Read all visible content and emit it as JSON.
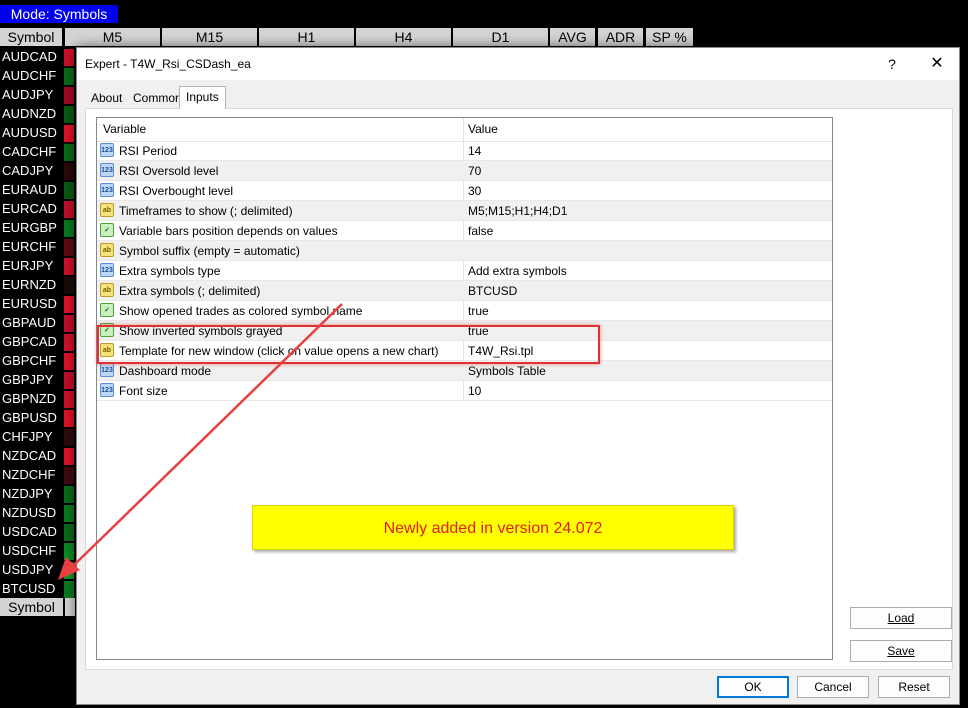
{
  "dashboard": {
    "mode_label": "Mode: Symbols",
    "header": [
      "Symbol",
      "M5",
      "M15",
      "H1",
      "H4",
      "D1",
      "AVG",
      "ADR",
      "SP %"
    ],
    "symbols": [
      "AUDCAD",
      "AUDCHF",
      "AUDJPY",
      "AUDNZD",
      "AUDUSD",
      "CADCHF",
      "CADJPY",
      "EURAUD",
      "EURCAD",
      "EURGBP",
      "EURCHF",
      "EURJPY",
      "EURNZD",
      "EURUSD",
      "GBPAUD",
      "GBPCAD",
      "GBPCHF",
      "GBPJPY",
      "GBPNZD",
      "GBPUSD",
      "CHFJPY",
      "NZDCAD",
      "NZDCHF",
      "NZDJPY",
      "NZDUSD",
      "USDCAD",
      "USDCHF",
      "USDJPY",
      "BTCUSD"
    ],
    "cell_colors": [
      "#d0102a",
      "#0a6a1a",
      "#a00a20",
      "#0a5a14",
      "#e0102a",
      "#0a6a1a",
      "#2a0a0a",
      "#0a5a14",
      "#c01028",
      "#0a7a1e",
      "#600a14",
      "#d0102a",
      "#1a0a0a",
      "#e0102a",
      "#c01028",
      "#d0102a",
      "#e0102a",
      "#c01028",
      "#d0102a",
      "#e0102a",
      "#300a0a",
      "#e0102a",
      "#400a10",
      "#0a6a1a",
      "#0a7a1e",
      "#0a6a1a",
      "#0a8a22",
      "#0a9a26",
      "#0a7a1e"
    ],
    "footer_label": "Symbol"
  },
  "dialog": {
    "title": "Expert - T4W_Rsi_CSDash_ea",
    "help": "?",
    "close": "✕",
    "tabs": [
      "About",
      "Common",
      "Inputs"
    ],
    "active_tab": "Inputs",
    "columns": {
      "variable": "Variable",
      "value": "Value"
    },
    "rows": [
      {
        "icon": "123",
        "type": "num",
        "name": "RSI Period",
        "value": "14"
      },
      {
        "icon": "123",
        "type": "num",
        "name": "RSI Oversold level",
        "value": "70"
      },
      {
        "icon": "123",
        "type": "num",
        "name": "RSI Overbought level",
        "value": "30"
      },
      {
        "icon": "ab",
        "type": "txt",
        "name": "Timeframes to show (; delimited)",
        "value": "M5;M15;H1;H4;D1"
      },
      {
        "icon": "✓",
        "type": "bool",
        "name": "Variable bars position depends on values",
        "value": "false"
      },
      {
        "icon": "ab",
        "type": "txt",
        "name": "Symbol suffix (empty = automatic)",
        "value": ""
      },
      {
        "icon": "123",
        "type": "num",
        "name": "Extra symbols type",
        "value": "Add extra symbols"
      },
      {
        "icon": "ab",
        "type": "txt",
        "name": "Extra symbols (; delimited)",
        "value": "BTCUSD"
      },
      {
        "icon": "✓",
        "type": "bool",
        "name": "Show opened trades as colored symbol name",
        "value": "true"
      },
      {
        "icon": "✓",
        "type": "bool",
        "name": "Show inverted symbols grayed",
        "value": "true"
      },
      {
        "icon": "ab",
        "type": "txt",
        "name": "Template for new window (click on value opens a new chart)",
        "value": "T4W_Rsi.tpl"
      },
      {
        "icon": "123",
        "type": "num",
        "name": "Dashboard mode",
        "value": "Symbols Table"
      },
      {
        "icon": "123",
        "type": "num",
        "name": "Font size",
        "value": "10"
      }
    ],
    "annotation": "Newly added in version 24.072",
    "buttons": {
      "load": "Load",
      "save": "Save",
      "ok": "OK",
      "cancel": "Cancel",
      "reset": "Reset"
    }
  },
  "colors": {
    "mode_button": "#0000ee",
    "highlight": "#e03030",
    "note_bg": "#ffff00",
    "note_text": "#e02020"
  }
}
